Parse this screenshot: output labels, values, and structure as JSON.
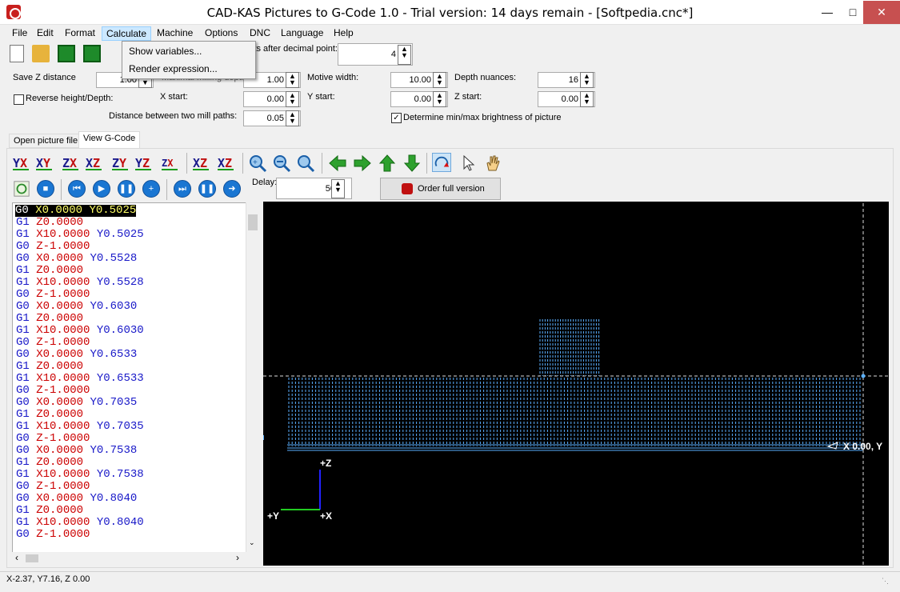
{
  "window": {
    "title": "CAD-KAS Pictures to G-Code 1.0 - Trial version: 14 days remain - [Softpedia.cnc*]"
  },
  "menu": [
    "File",
    "Edit",
    "Format",
    "Calculate",
    "Machine",
    "Options",
    "DNC",
    "Language",
    "Help"
  ],
  "dropdown": [
    "Show variables...",
    "Render expression..."
  ],
  "params": {
    "digits_label": "its after decimal point:",
    "digits_value": "4",
    "save_z_label": "Save Z distance",
    "save_z_value": "1.00",
    "max_depth_label": "Maximal milling depth",
    "max_depth_value": "1.00",
    "motive_width_label": "Motive width:",
    "motive_width_value": "10.00",
    "depth_nuances_label": "Depth nuances:",
    "depth_nuances_value": "16",
    "reverse_label": "Reverse height/Depth:",
    "x_start_label": "X start:",
    "x_start_value": "0.00",
    "y_start_label": "Y start:",
    "y_start_value": "0.00",
    "z_start_label": "Z start:",
    "z_start_value": "0.00",
    "dist_label": "Distance between two mill paths:",
    "dist_value": "0.05",
    "brightness_label": "Determine min/max brightness of picture"
  },
  "tabs": [
    "Open picture file",
    "View G-Code"
  ],
  "view_buttons": [
    [
      "Y",
      "X"
    ],
    [
      "X",
      "Y"
    ],
    [
      "Z",
      "X"
    ],
    [
      "X",
      "Z"
    ],
    [
      "Z",
      "Y"
    ],
    [
      "Y",
      "Z"
    ],
    [
      "Z",
      "X"
    ],
    [
      "X",
      "Z"
    ],
    [
      "X",
      "Z"
    ]
  ],
  "player": {
    "delay_label": "Delay:",
    "delay_value": "50",
    "order_label": "Order full version"
  },
  "gcode": [
    [
      "G0 ",
      "X0.0000 ",
      "Y0.5025"
    ],
    [
      "G1 ",
      "Z0.0000",
      ""
    ],
    [
      "G1 ",
      "X10.0000 ",
      "Y0.5025"
    ],
    [
      "G0 ",
      "Z-1.0000",
      ""
    ],
    [
      "G0 ",
      "X0.0000 ",
      "Y0.5528"
    ],
    [
      "G1 ",
      "Z0.0000",
      ""
    ],
    [
      "G1 ",
      "X10.0000 ",
      "Y0.5528"
    ],
    [
      "G0 ",
      "Z-1.0000",
      ""
    ],
    [
      "G0 ",
      "X0.0000 ",
      "Y0.6030"
    ],
    [
      "G1 ",
      "Z0.0000",
      ""
    ],
    [
      "G1 ",
      "X10.0000 ",
      "Y0.6030"
    ],
    [
      "G0 ",
      "Z-1.0000",
      ""
    ],
    [
      "G0 ",
      "X0.0000 ",
      "Y0.6533"
    ],
    [
      "G1 ",
      "Z0.0000",
      ""
    ],
    [
      "G1 ",
      "X10.0000 ",
      "Y0.6533"
    ],
    [
      "G0 ",
      "Z-1.0000",
      ""
    ],
    [
      "G0 ",
      "X0.0000 ",
      "Y0.7035"
    ],
    [
      "G1 ",
      "Z0.0000",
      ""
    ],
    [
      "G1 ",
      "X10.0000 ",
      "Y0.7035"
    ],
    [
      "G0 ",
      "Z-1.0000",
      ""
    ],
    [
      "G0 ",
      "X0.0000 ",
      "Y0.7538"
    ],
    [
      "G1 ",
      "Z0.0000",
      ""
    ],
    [
      "G1 ",
      "X10.0000 ",
      "Y0.7538"
    ],
    [
      "G0 ",
      "Z-1.0000",
      ""
    ],
    [
      "G0 ",
      "X0.0000 ",
      "Y0.8040"
    ],
    [
      "G1 ",
      "Z0.0000",
      ""
    ],
    [
      "G1 ",
      "X10.0000 ",
      "Y0.8040"
    ],
    [
      "G0 ",
      "Z-1.0000",
      ""
    ]
  ],
  "viewport": {
    "axis_z": "+Z",
    "axis_y": "+Y",
    "axis_x": "+X",
    "cursor_label": "X 0.00, Y"
  },
  "status": "X-2.37, Y7.16, Z 0.00",
  "colors": {
    "accent": "#1a76d2",
    "path": "#5ab0ff",
    "gcode_head": "#1818c8",
    "gcode_val": "#cc0000"
  }
}
